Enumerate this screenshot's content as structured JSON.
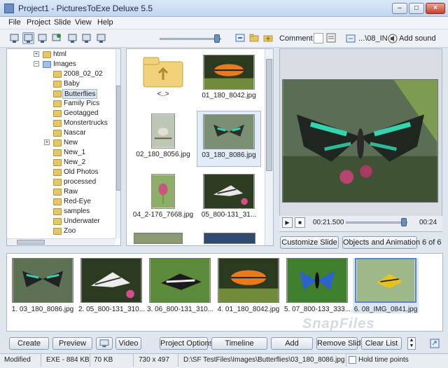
{
  "window": {
    "title": "Project1 - PicturesToExe Deluxe 5.5"
  },
  "menu": [
    "File",
    "Project",
    "Slide",
    "View",
    "Help"
  ],
  "toolbar": {
    "comment_label": "Comment",
    "path_text": "...\\08_IN",
    "add_sound_label": "Add sound"
  },
  "tree": {
    "items": [
      "html",
      "Images",
      "2008_02_02",
      "Baby",
      "Butterflies",
      "Family Pics",
      "Geotagged",
      "Monstertrucks",
      "Nascar",
      "New",
      "New_1",
      "New_2",
      "Old Photos",
      "processed",
      "Raw",
      "Red-Eye",
      "samples",
      "Underwater",
      "Zoo"
    ],
    "selected": "Butterflies"
  },
  "files": [
    {
      "name": "<..>",
      "kind": "folder"
    },
    {
      "name": "01_180_8042.jpg",
      "kind": "image",
      "selected": false
    },
    {
      "name": "02_180_8056.jpg",
      "kind": "image",
      "selected": false
    },
    {
      "name": "03_180_8086.jpg",
      "kind": "image",
      "selected": true
    },
    {
      "name": "04_2-176_7668.jpg",
      "kind": "image",
      "selected": false
    },
    {
      "name": "05_800-131_31...",
      "kind": "image",
      "selected": false
    }
  ],
  "player": {
    "current_time": "00:21.500",
    "total_time": "00:24",
    "position": 0.9
  },
  "preview_buttons": {
    "customize": "Customize Slide",
    "objects": "Objects and Animation",
    "counter": "6 of 6"
  },
  "slides": [
    {
      "caption": "1. 03_180_8086.jpg",
      "selected": false
    },
    {
      "caption": "2. 05_800-131_310...",
      "selected": false
    },
    {
      "caption": "3. 06_800-131_310...",
      "selected": false
    },
    {
      "caption": "4. 01_180_8042.jpg",
      "selected": false
    },
    {
      "caption": "5. 07_800-133_333...",
      "selected": false
    },
    {
      "caption": "6. 08_IMG_0841.jpg",
      "selected": true
    }
  ],
  "bottom_buttons": {
    "create": "Create",
    "preview": "Preview",
    "video": "Video",
    "project_options": "Project Options",
    "timeline": "Timeline",
    "add": "Add",
    "remove_slide": "Remove Slide",
    "clear_list": "Clear List"
  },
  "status": {
    "mode": "Modified",
    "exe_size": "EXE - 884 KB",
    "image_size": "70 KB",
    "dimensions": "730 x 497",
    "path": "D:\\SF TestFiles\\Images\\Butterflies\\03_180_8086.jpg",
    "hold_time_points": "Hold time points"
  },
  "watermark": "SnapFiles",
  "colors": {
    "selection": "#dbe6f4",
    "accent": "#5a87c4",
    "folder": "#e5c766"
  }
}
